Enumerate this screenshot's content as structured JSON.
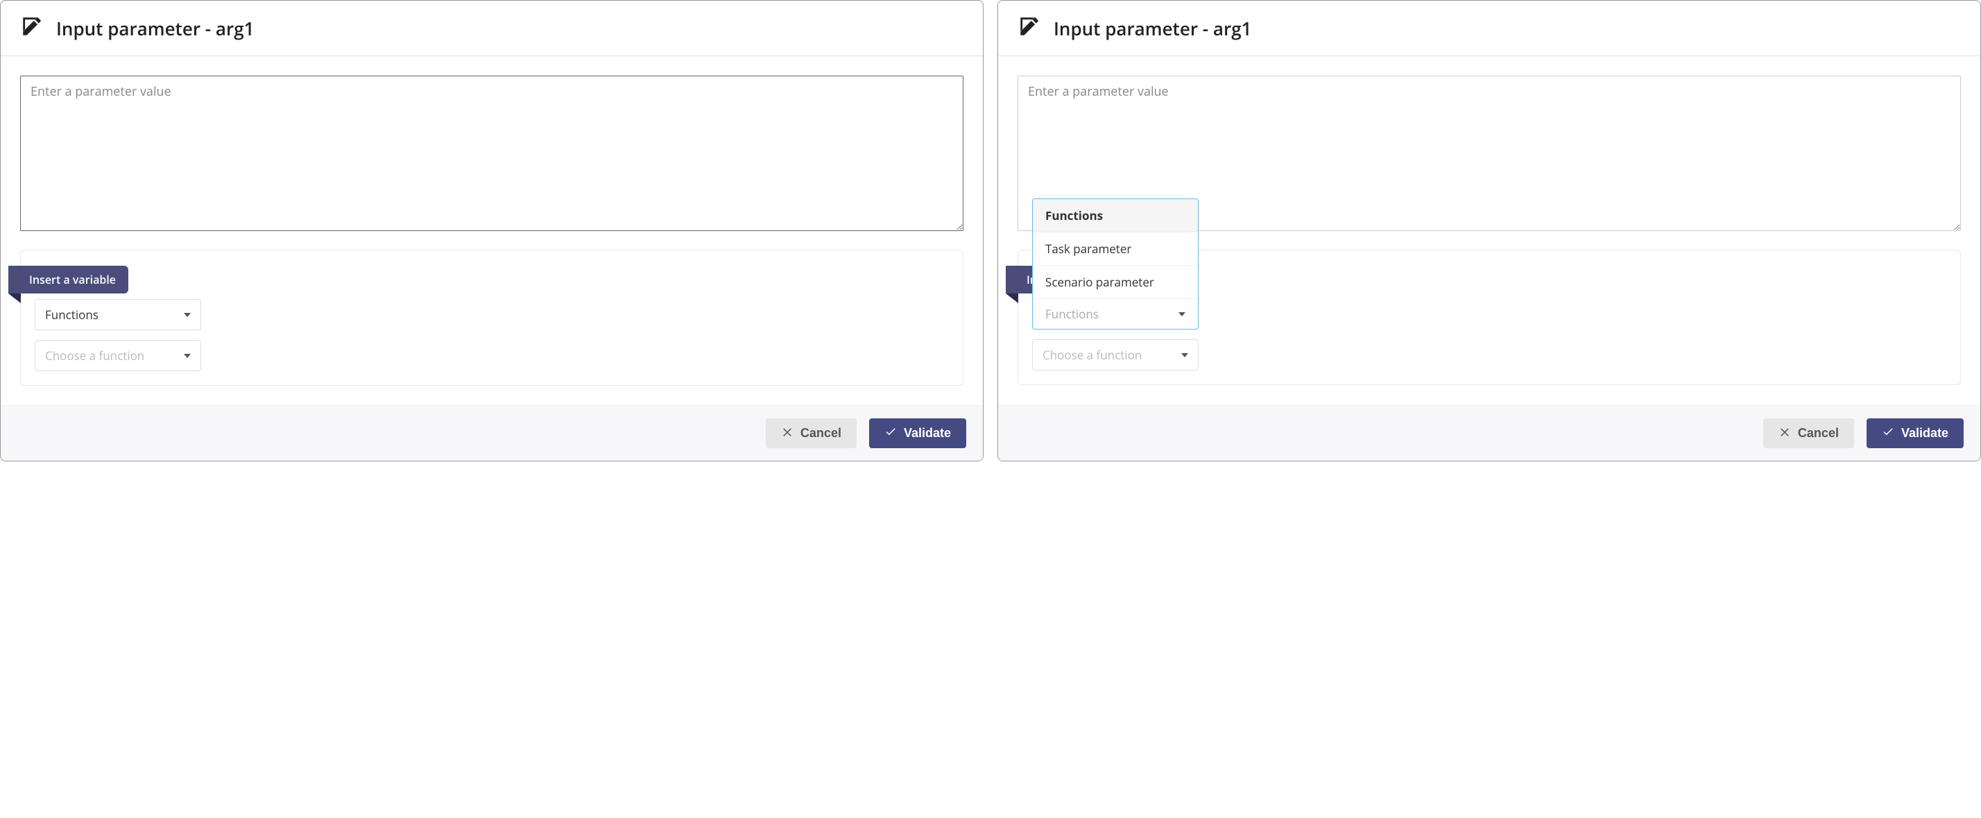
{
  "left": {
    "header_title": "Input parameter - arg1",
    "textarea_placeholder": "Enter a parameter value",
    "insert_tag_label": "Insert a variable",
    "select_category_value": "Functions",
    "select_function_placeholder": "Choose a function",
    "footer": {
      "cancel_label": "Cancel",
      "validate_label": "Validate"
    }
  },
  "right": {
    "header_title": "Input parameter - arg1",
    "textarea_placeholder": "Enter a parameter value",
    "insert_tag_label": "Insert a variable",
    "category_dropdown": {
      "options": [
        "Functions",
        "Task parameter",
        "Scenario parameter"
      ],
      "search_placeholder": "Functions"
    },
    "select_function_placeholder": "Choose a function",
    "footer": {
      "cancel_label": "Cancel",
      "validate_label": "Validate"
    }
  }
}
